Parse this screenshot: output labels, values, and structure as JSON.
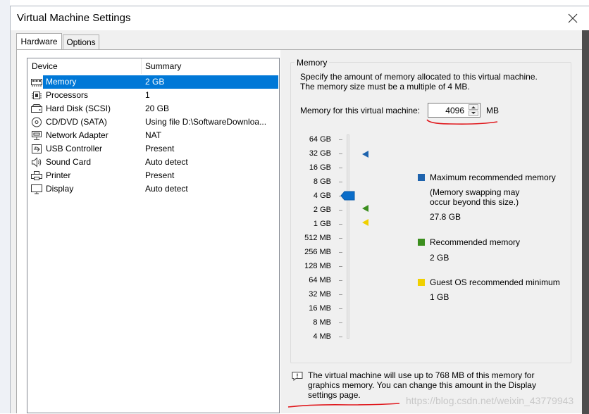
{
  "window": {
    "title": "Virtual Machine Settings"
  },
  "tabs": [
    {
      "label": "Hardware",
      "active": true
    },
    {
      "label": "Options",
      "active": false
    }
  ],
  "device_list": {
    "headers": {
      "device": "Device",
      "summary": "Summary"
    },
    "rows": [
      {
        "device": "Memory",
        "summary": "2 GB",
        "icon": "memory-icon",
        "selected": true
      },
      {
        "device": "Processors",
        "summary": "1",
        "icon": "processor-icon",
        "selected": false
      },
      {
        "device": "Hard Disk (SCSI)",
        "summary": "20 GB",
        "icon": "hard-disk-icon",
        "selected": false
      },
      {
        "device": "CD/DVD (SATA)",
        "summary": "Using file D:\\SoftwareDownloa...",
        "icon": "cd-dvd-icon",
        "selected": false
      },
      {
        "device": "Network Adapter",
        "summary": "NAT",
        "icon": "network-adapter-icon",
        "selected": false
      },
      {
        "device": "USB Controller",
        "summary": "Present",
        "icon": "usb-icon",
        "selected": false
      },
      {
        "device": "Sound Card",
        "summary": "Auto detect",
        "icon": "speaker-icon",
        "selected": false
      },
      {
        "device": "Printer",
        "summary": "Present",
        "icon": "printer-icon",
        "selected": false
      },
      {
        "device": "Display",
        "summary": "Auto detect",
        "icon": "monitor-icon",
        "selected": false
      }
    ]
  },
  "memory": {
    "group_title": "Memory",
    "description_line1": "Specify the amount of memory allocated to this virtual machine.",
    "description_line2": "The memory size must be a multiple of 4 MB.",
    "field_label": "Memory for this virtual machine:",
    "value": "4096",
    "unit": "MB",
    "scale_labels": [
      "64 GB",
      "32 GB",
      "16 GB",
      "8 GB",
      "4 GB",
      "2 GB",
      "1 GB",
      "512 MB",
      "256 MB",
      "128 MB",
      "64 MB",
      "32 MB",
      "16 MB",
      "8 MB",
      "4 MB"
    ],
    "slider_value": "4 GB",
    "legend": {
      "max_title": "Maximum recommended memory",
      "max_note_line1": "(Memory swapping may",
      "max_note_line2": "occur beyond this size.)",
      "max_value": "27.8 GB",
      "rec_title": "Recommended memory",
      "rec_value": "2 GB",
      "min_title": "Guest OS recommended minimum",
      "min_value": "1 GB"
    },
    "legend_colors": {
      "max": "#1e63ad",
      "rec": "#3b8e1e",
      "min": "#f0d000"
    },
    "info_line1": "The virtual machine will use up to 768 MB of this memory for",
    "info_line2": "graphics memory. You can change this amount in the Display",
    "info_line3": "settings page."
  },
  "watermark": "https://blog.csdn.net/weixin_43779943",
  "colors": {
    "selection": "#0078d7",
    "annotation": "#e0191e"
  }
}
